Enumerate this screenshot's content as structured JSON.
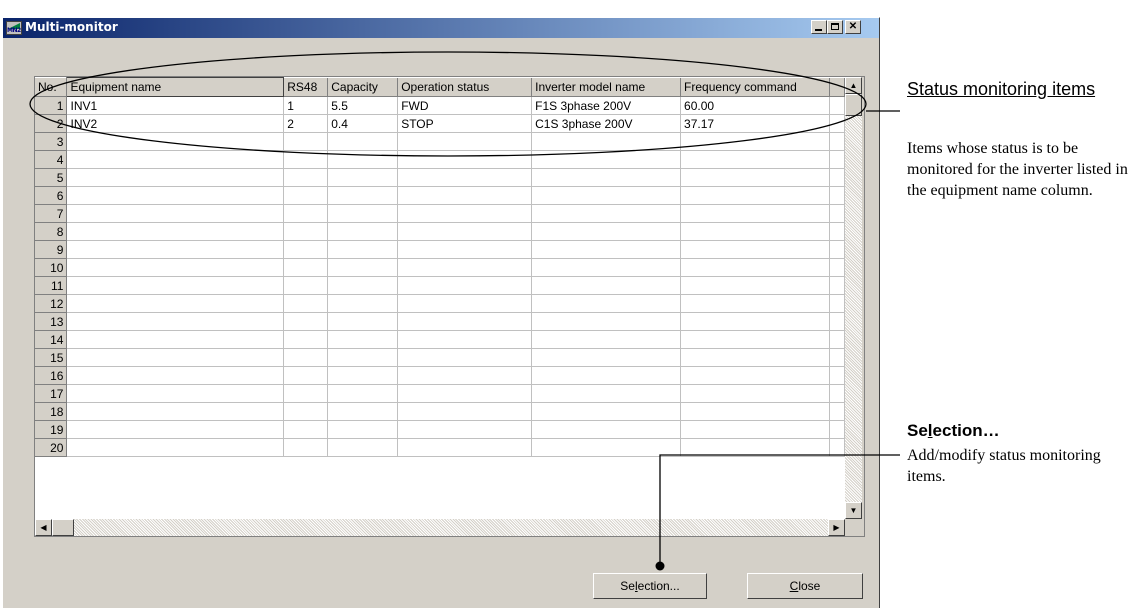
{
  "window": {
    "title": "Multi-monitor",
    "icon_text": "MN2",
    "min_glyph": "_",
    "max_glyph": "□",
    "close_glyph": "✕"
  },
  "grid": {
    "columns": [
      "No.",
      "Equipment name",
      "RS48",
      "Capacity",
      "Operation status",
      "Inverter model name",
      "Frequency command"
    ],
    "rows": [
      {
        "no": "1",
        "equipment": "INV1",
        "rs": "1",
        "capacity": "5.5",
        "status": "FWD",
        "model": "F1S 3phase 200V",
        "freq": "60.00"
      },
      {
        "no": "2",
        "equipment": "INV2",
        "rs": "2",
        "capacity": "0.4",
        "status": "STOP",
        "model": "C1S 3phase 200V",
        "freq": "37.17"
      },
      {
        "no": "3"
      },
      {
        "no": "4"
      },
      {
        "no": "5"
      },
      {
        "no": "6"
      },
      {
        "no": "7"
      },
      {
        "no": "8"
      },
      {
        "no": "9"
      },
      {
        "no": "10"
      },
      {
        "no": "11"
      },
      {
        "no": "12"
      },
      {
        "no": "13"
      },
      {
        "no": "14"
      },
      {
        "no": "15"
      },
      {
        "no": "16"
      },
      {
        "no": "17"
      },
      {
        "no": "18"
      },
      {
        "no": "19"
      },
      {
        "no": "20"
      }
    ]
  },
  "buttons": {
    "selection_pre": "Se",
    "selection_key": "l",
    "selection_post": "ection...",
    "close_key": "C",
    "close_post": "lose"
  },
  "annotations": {
    "status_title": "Status monitoring items",
    "status_desc": "Items whose status is to be monitored for the inverter listed in the equipment name column.",
    "selection_title_pre": "Se",
    "selection_title_key": "l",
    "selection_title_post": "ection…",
    "selection_desc": "Add/modify status monitoring items."
  }
}
